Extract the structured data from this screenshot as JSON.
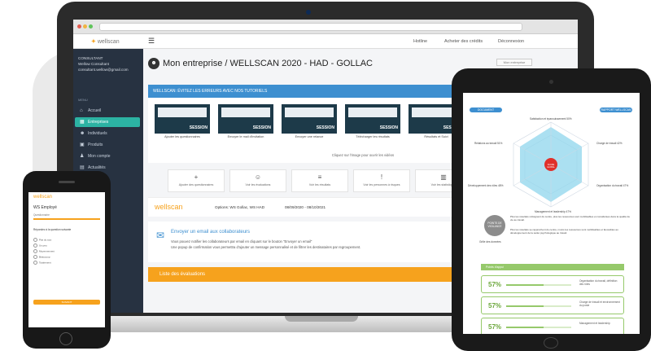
{
  "laptop": {
    "brand": "wellscan",
    "top_nav": [
      "Hotline",
      "Acheter des crédits",
      "Déconnexion"
    ],
    "sidebar": {
      "user_lines": [
        "CONSULTANT",
        "Wellow Consultant",
        "consultant.wellow@gmail.com"
      ],
      "menu_label": "MENU",
      "items": [
        {
          "label": "Accueil",
          "icon": "home-icon",
          "active": false
        },
        {
          "label": "Entreprises",
          "icon": "building-icon",
          "active": true
        },
        {
          "label": "Individuels",
          "icon": "users-icon",
          "active": false
        },
        {
          "label": "Produits",
          "icon": "box-icon",
          "active": false
        },
        {
          "label": "Mon compte",
          "icon": "user-icon",
          "active": false
        },
        {
          "label": "Actualités",
          "icon": "news-icon",
          "active": false
        }
      ]
    },
    "page_title": "Mon entreprise / WELLSCAN 2020 - HAD - GOLLAC",
    "page_button": "Mon entreprise",
    "tutorial_header": "WELLSCAN: ÉVITEZ LES ERREURS AVEC NOS TUTORIELS",
    "tutorials": [
      {
        "label": "SESSION",
        "caption": "Ajouter les questionnaires"
      },
      {
        "label": "SESSION",
        "caption": "Envoyer le mail d'invitation"
      },
      {
        "label": "SESSION",
        "caption": "Envoyer une relance"
      },
      {
        "label": "SESSION",
        "caption": "Télécharger les résultats"
      },
      {
        "label": "SESSION",
        "caption": "Résultats et Suivi"
      }
    ],
    "tutorial_hint": "Cliquez sur l'image pour ouvrir les vidéos",
    "actions": [
      {
        "icon": "+",
        "label": "Ajouter des questionnaires"
      },
      {
        "icon": "☺",
        "label": "Voir les évaluations"
      },
      {
        "icon": "≡",
        "label": "Voir les résultats"
      },
      {
        "icon": "!",
        "label": "Voir les personnes à risques"
      },
      {
        "icon": "▥",
        "label": "Voir les statistiques"
      }
    ],
    "info": {
      "logo": "wellscan",
      "options": "Options: WS Gollac, WS HAD",
      "dates": "08/09/2020 - 08/10/2021"
    },
    "mail": {
      "title": "Envoyer un email aux collaborateurs",
      "line1": "Vous pouvez notifier les collaborateurs par email en cliquant sur le bouton \"Envoyer un email\"",
      "line2": "Une popup de confirmation vous permettra d'ajouter un message personnalisé et de filtrer les destinataires par regroupement."
    },
    "evaluations_header": "Liste des évaluations"
  },
  "tablet": {
    "pills": [
      "DOCUMENT RÉSULTATS",
      "RAPPORT WELLSCAN"
    ],
    "radar_axes": [
      "Satisfaction et épanouissement 50%",
      "Charge de travail 42%",
      "Organisation du travail 47%",
      "Management et leadership 47%",
      "Développement des rôles 48%",
      "Relations au travail 51%"
    ],
    "radar_center": "SCORE GLOBAL",
    "legend_circle": "POINTS DE VIGILANCE",
    "legend_side": "Grille des données",
    "bullets": [
      "Plus les résultats s'éloignent du centre, plus les ressources sont mobilisables et considérées dans la qualité de vie au travail.",
      "Plus les résultats se rapprochent du centre, moins les ressources sont mobilisables et favorables au développement de la santé psychologique au travail."
    ],
    "section_header": "Points d'appui",
    "scores": [
      {
        "pct": "57%",
        "text": "Organisation du travail, définition des rôles",
        "level": 0.57
      },
      {
        "pct": "57%",
        "text": "Charge de travail et environnement du poste",
        "level": 0.57
      },
      {
        "pct": "57%",
        "text": "Management et leadership",
        "level": 0.57
      }
    ]
  },
  "phone": {
    "logo": "wellscan",
    "title": "WS Employé",
    "subtitle": "Questionnaire",
    "question": "Répondez à la question suivante",
    "options": [
      "Pas du tout",
      "Un peu",
      "Moyennement",
      "Beaucoup",
      "Totalement"
    ],
    "button": "SUIVANT"
  }
}
